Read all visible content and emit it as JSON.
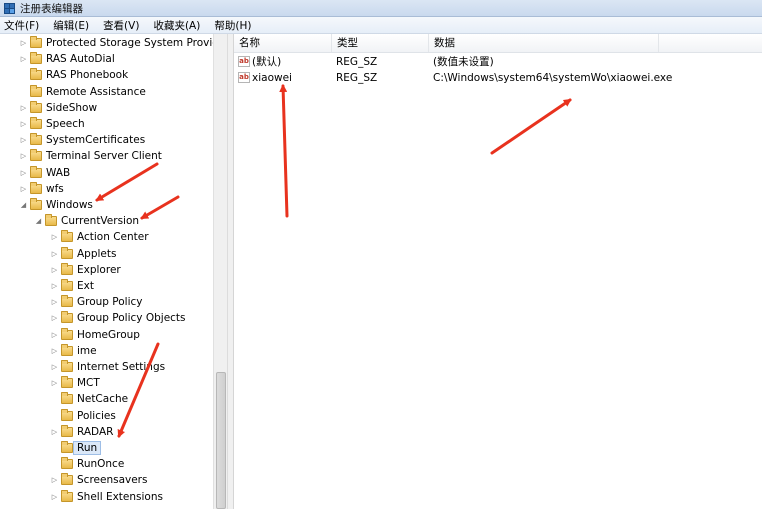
{
  "window": {
    "title": "注册表编辑器"
  },
  "menu": [
    {
      "label": "文件(F)"
    },
    {
      "label": "编辑(E)"
    },
    {
      "label": "查看(V)"
    },
    {
      "label": "收藏夹(A)"
    },
    {
      "label": "帮助(H)"
    }
  ],
  "tree": {
    "items": [
      {
        "label": "Protected Storage System Provider",
        "level": 1,
        "expander": "▷"
      },
      {
        "label": "RAS AutoDial",
        "level": 1,
        "expander": "▷"
      },
      {
        "label": "RAS Phonebook",
        "level": 1,
        "expander": ""
      },
      {
        "label": "Remote Assistance",
        "level": 1,
        "expander": ""
      },
      {
        "label": "SideShow",
        "level": 1,
        "expander": "▷"
      },
      {
        "label": "Speech",
        "level": 1,
        "expander": "▷"
      },
      {
        "label": "SystemCertificates",
        "level": 1,
        "expander": "▷"
      },
      {
        "label": "Terminal Server Client",
        "level": 1,
        "expander": "▷"
      },
      {
        "label": "WAB",
        "level": 1,
        "expander": "▷"
      },
      {
        "label": "wfs",
        "level": 1,
        "expander": "▷"
      },
      {
        "label": "Windows",
        "level": 1,
        "expander": "◢"
      },
      {
        "label": "CurrentVersion",
        "level": 2,
        "expander": "◢"
      },
      {
        "label": "Action Center",
        "level": 3,
        "expander": "▷"
      },
      {
        "label": "Applets",
        "level": 3,
        "expander": "▷"
      },
      {
        "label": "Explorer",
        "level": 3,
        "expander": "▷"
      },
      {
        "label": "Ext",
        "level": 3,
        "expander": "▷"
      },
      {
        "label": "Group Policy",
        "level": 3,
        "expander": "▷"
      },
      {
        "label": "Group Policy Objects",
        "level": 3,
        "expander": "▷"
      },
      {
        "label": "HomeGroup",
        "level": 3,
        "expander": "▷"
      },
      {
        "label": "ime",
        "level": 3,
        "expander": "▷"
      },
      {
        "label": "Internet Settings",
        "level": 3,
        "expander": "▷"
      },
      {
        "label": "MCT",
        "level": 3,
        "expander": "▷"
      },
      {
        "label": "NetCache",
        "level": 3,
        "expander": ""
      },
      {
        "label": "Policies",
        "level": 3,
        "expander": ""
      },
      {
        "label": "RADAR",
        "level": 3,
        "expander": "▷"
      },
      {
        "label": "Run",
        "level": 3,
        "expander": "",
        "selected": true
      },
      {
        "label": "RunOnce",
        "level": 3,
        "expander": ""
      },
      {
        "label": "Screensavers",
        "level": 3,
        "expander": "▷"
      },
      {
        "label": "Shell Extensions",
        "level": 3,
        "expander": "▷"
      }
    ]
  },
  "list": {
    "columns": [
      "名称",
      "类型",
      "数据"
    ],
    "rows": [
      {
        "icon": "string-value-icon",
        "name": "(默认)",
        "type": "REG_SZ",
        "data": "(数值未设置)"
      },
      {
        "icon": "string-value-icon",
        "name": "xiaowei",
        "type": "REG_SZ",
        "data": "C:\\Windows\\system64\\systemWo\\xiaowei.exe"
      }
    ]
  },
  "annotations": {
    "arrow_color": "#e8321e"
  }
}
